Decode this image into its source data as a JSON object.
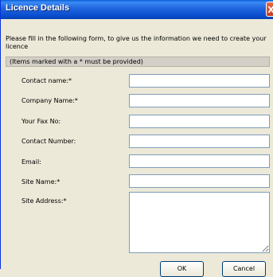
{
  "window": {
    "title": "Licence Details",
    "close_glyph": "X"
  },
  "intro": "Please fill in the following form, to give us the information we need to create your licence",
  "note": "(Items marked with a * must be provided)",
  "fields": {
    "contact_name": {
      "label": "Contact name:*",
      "value": ""
    },
    "company_name": {
      "label": "Company Name:*",
      "value": ""
    },
    "fax": {
      "label": "Your Fax No:",
      "value": ""
    },
    "contact_number": {
      "label": "Contact Number:",
      "value": ""
    },
    "email": {
      "label": "Email:",
      "value": ""
    },
    "site_name": {
      "label": "Site Name:*",
      "value": ""
    },
    "site_address": {
      "label": "Site Address:*",
      "value": ""
    }
  },
  "buttons": {
    "ok": "OK",
    "cancel": "Cancel"
  }
}
